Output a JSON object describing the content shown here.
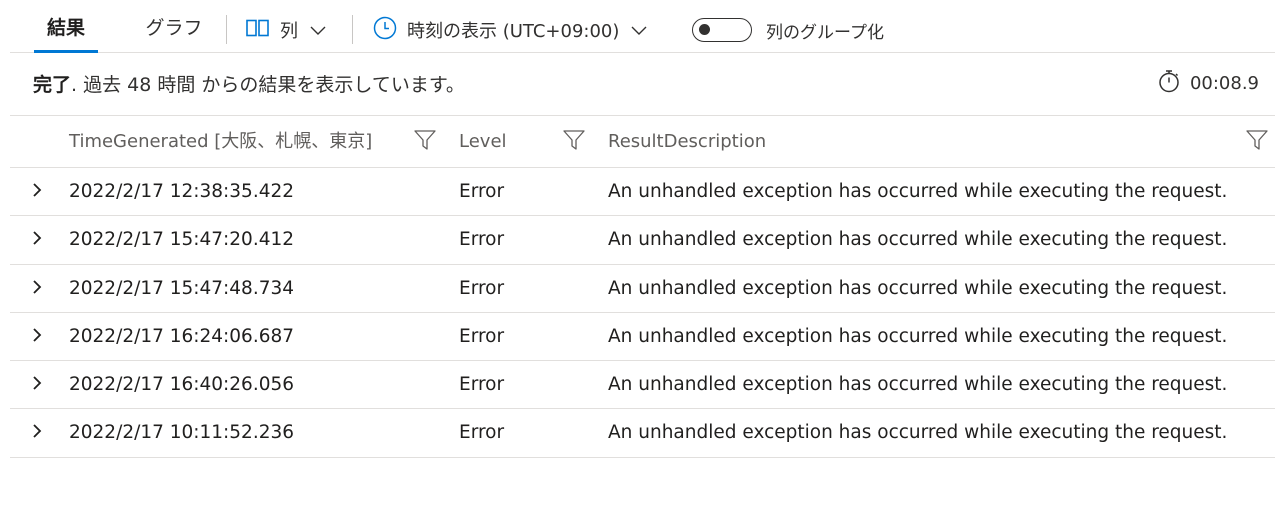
{
  "toolbar": {
    "tabs": [
      {
        "label": "結果",
        "active": true
      },
      {
        "label": "グラフ",
        "active": false
      }
    ],
    "columns_label": "列",
    "time_display_label": "時刻の表示 (UTC+09:00)",
    "group_columns_label": "列のグループ化",
    "group_columns_enabled": false
  },
  "status": {
    "done_label": "完了",
    "message": ". 過去 48 時間 からの結果を表示しています。",
    "elapsed": "00:08.9"
  },
  "table": {
    "headers": [
      "TimeGenerated [大阪、札幌、東京]",
      "Level",
      "ResultDescription"
    ],
    "rows": [
      {
        "time": "2022/2/17 12:38:35.422",
        "level": "Error",
        "description": "An unhandled exception has occurred while executing the request."
      },
      {
        "time": "2022/2/17 15:47:20.412",
        "level": "Error",
        "description": "An unhandled exception has occurred while executing the request."
      },
      {
        "time": "2022/2/17 15:47:48.734",
        "level": "Error",
        "description": "An unhandled exception has occurred while executing the request."
      },
      {
        "time": "2022/2/17 16:24:06.687",
        "level": "Error",
        "description": "An unhandled exception has occurred while executing the request."
      },
      {
        "time": "2022/2/17 16:40:26.056",
        "level": "Error",
        "description": "An unhandled exception has occurred while executing the request."
      },
      {
        "time": "2022/2/17 10:11:52.236",
        "level": "Error",
        "description": "An unhandled exception has occurred while executing the request."
      }
    ]
  },
  "colors": {
    "accent": "#0078d4",
    "text": "#323130",
    "border": "#e1dfdd"
  }
}
